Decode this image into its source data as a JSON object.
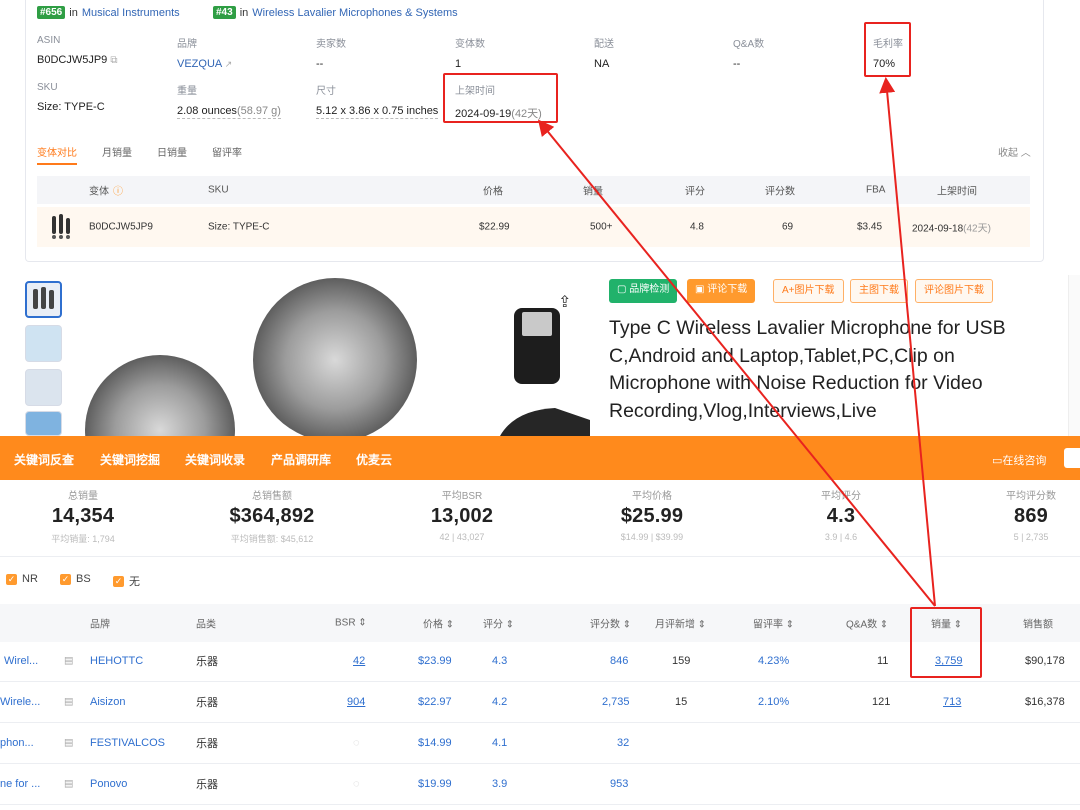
{
  "ranks": [
    {
      "badge": "#656",
      "in": "in",
      "category": "Musical Instruments"
    },
    {
      "badge": "#43",
      "in": "in",
      "category": "Wireless Lavalier Microphones & Systems"
    }
  ],
  "attributes": {
    "asin": {
      "label": "ASIN",
      "value": "B0DCJW5JP9"
    },
    "brand": {
      "label": "品牌",
      "value": "VEZQUA"
    },
    "sellers": {
      "label": "卖家数",
      "value": "--"
    },
    "variants": {
      "label": "变体数",
      "value": "1"
    },
    "shipping": {
      "label": "配送",
      "value": "NA"
    },
    "qa": {
      "label": "Q&A数",
      "value": "--"
    },
    "margin": {
      "label": "毛利率",
      "value": "70%"
    },
    "sku": {
      "label": "SKU",
      "value": "Size: TYPE-C"
    },
    "weight": {
      "label": "重量",
      "value": "2.08 ounces",
      "extra": "(58.97 g)"
    },
    "size": {
      "label": "尺寸",
      "value": "5.12 x 3.86 x 0.75 inches"
    },
    "launch": {
      "label": "上架时间",
      "value": "2024-09-19",
      "extra": "(42天)"
    }
  },
  "subtabs": [
    "变体对比",
    "月销量",
    "日销量",
    "留评率"
  ],
  "collapse_label": "收起",
  "variant_table": {
    "headers": {
      "variant": "变体",
      "sku": "SKU",
      "price": "价格",
      "sales": "销量",
      "rating": "评分",
      "reviews": "评分数",
      "fba": "FBA",
      "launch": "上架时间"
    },
    "row": {
      "asin": "B0DCJW5JP9",
      "sku": "Size: TYPE-C",
      "price": "$22.99",
      "sales": "500+",
      "rating": "4.8",
      "reviews": "69",
      "fba": "$3.45",
      "launch": "2024-09-18",
      "launch_extra": "(42天)"
    }
  },
  "buttons": {
    "check": "品牌检测",
    "review_dl": "评论下载",
    "aplus": "A+图片下载",
    "main_img": "主图下载",
    "review_img": "评论图片下载"
  },
  "product_title": "Type C Wireless Lavalier Microphone for USB C,Android and Laptop,Tablet,PC,Clip on Microphone with Noise Reduction for Video Recording,Vlog,Interviews,Live",
  "nav": {
    "items": [
      "关键词反查",
      "关键词挖掘",
      "关键词收录",
      "产品调研库",
      "优麦云"
    ],
    "consult": "在线咨询"
  },
  "stats": [
    {
      "label": "总销量",
      "value": "14,354",
      "sub": "平均销量: 1,794"
    },
    {
      "label": "总销售额",
      "value": "$364,892",
      "sub": "平均销售额: $45,612"
    },
    {
      "label": "平均BSR",
      "value": "13,002",
      "sub": "42 | 43,027"
    },
    {
      "label": "平均价格",
      "value": "$25.99",
      "sub": "$14.99 | $39.99"
    },
    {
      "label": "平均评分",
      "value": "4.3",
      "sub": "3.9 | 4.6"
    },
    {
      "label": "平均评分数",
      "value": "869",
      "sub": "5 | 2,735"
    }
  ],
  "filters": [
    "NR",
    "BS",
    "无"
  ],
  "table": {
    "headers": {
      "brand": "品牌",
      "category": "品类",
      "bsr": "BSR",
      "price": "价格",
      "rating": "评分",
      "reviews": "评分数",
      "monthly_new": "月评新增",
      "review_rate": "留评率",
      "qa": "Q&A数",
      "sales": "销量",
      "revenue": "销售额"
    },
    "rows": [
      {
        "title": "Wirel...",
        "brand": "HEHOTTC",
        "category": "乐器",
        "bsr": "42",
        "price": "$23.99",
        "rating": "4.3",
        "reviews": "846",
        "monthly_new": "159",
        "review_rate": "4.23%",
        "qa": "11",
        "sales": "3,759",
        "revenue": "$90,178"
      },
      {
        "title": "Wirele...",
        "brand": "Aisizon",
        "category": "乐器",
        "bsr": "904",
        "price": "$22.97",
        "rating": "4.2",
        "reviews": "2,735",
        "monthly_new": "15",
        "review_rate": "2.10%",
        "qa": "121",
        "sales": "713",
        "revenue": "$16,378"
      },
      {
        "title": "phon...",
        "brand": "FESTIVALCOS",
        "category": "乐器",
        "bsr": "",
        "price": "$14.99",
        "rating": "4.1",
        "reviews": "32",
        "monthly_new": "",
        "review_rate": "",
        "qa": "",
        "sales": "",
        "revenue": ""
      },
      {
        "title": "ne for ...",
        "brand": "Ponovo",
        "category": "乐器",
        "bsr": "",
        "price": "$19.99",
        "rating": "3.9",
        "reviews": "953",
        "monthly_new": "",
        "review_rate": "",
        "qa": "",
        "sales": "",
        "revenue": ""
      }
    ]
  },
  "colors": {
    "accent": "#ff8a1c",
    "link": "#2f6fcf",
    "highlight": "#e8231f",
    "rank_badge": "#2f9e44"
  }
}
